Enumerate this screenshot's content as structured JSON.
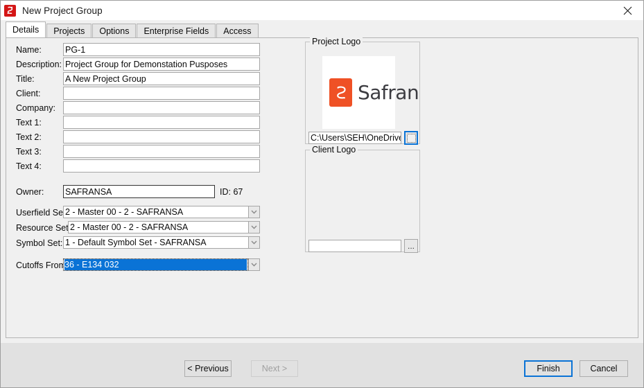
{
  "window": {
    "title": "New Project Group",
    "icon": "safran-logo-icon",
    "close_label": "✕"
  },
  "tabs": [
    {
      "label": "Details",
      "active": true
    },
    {
      "label": "Projects",
      "active": false
    },
    {
      "label": "Options",
      "active": false
    },
    {
      "label": "Enterprise Fields",
      "active": false
    },
    {
      "label": "Access",
      "active": false
    }
  ],
  "form": {
    "fields": [
      {
        "label": "Name:",
        "value": "PG-1"
      },
      {
        "label": "Description:",
        "value": "Project Group for Demonstation Pusposes"
      },
      {
        "label": "Title:",
        "value": "A New Project Group"
      },
      {
        "label": "Client:",
        "value": ""
      },
      {
        "label": "Company:",
        "value": ""
      },
      {
        "label": "Text 1:",
        "value": ""
      },
      {
        "label": "Text 2:",
        "value": ""
      },
      {
        "label": "Text 3:",
        "value": ""
      },
      {
        "label": "Text 4:",
        "value": ""
      }
    ],
    "owner": {
      "label": "Owner:",
      "value": "SAFRANSA",
      "id_text": "ID: 67"
    },
    "combos": [
      {
        "label": "Userfield Set:",
        "value": "2 - Master 00 - 2 - SAFRANSA",
        "selected": false
      },
      {
        "label": "Resource Set:",
        "value": "2 - Master 00 - 2 - SAFRANSA",
        "selected": false
      },
      {
        "label": "Symbol Set:",
        "value": "1 - Default Symbol Set - SAFRANSA",
        "selected": false
      },
      {
        "label": "Cutoffs From:",
        "value": "36 - E134 032",
        "selected": true
      }
    ]
  },
  "project_logo": {
    "title": "Project Logo",
    "logo_wordmark": "Safran",
    "path": "C:\\Users\\SEH\\OneDrive - S",
    "browse_label": "..."
  },
  "client_logo": {
    "title": "Client Logo",
    "path": "",
    "browse_label": "..."
  },
  "footer": {
    "previous_label": "< Previous",
    "next_label": "Next >",
    "finish_label": "Finish",
    "cancel_label": "Cancel"
  },
  "colors": {
    "accent": "#0a73d6",
    "brand_orange": "#ef5125",
    "brand_red": "#d41616",
    "window_bg": "#f0f0f0",
    "footer_bg": "#e1e1e1"
  }
}
